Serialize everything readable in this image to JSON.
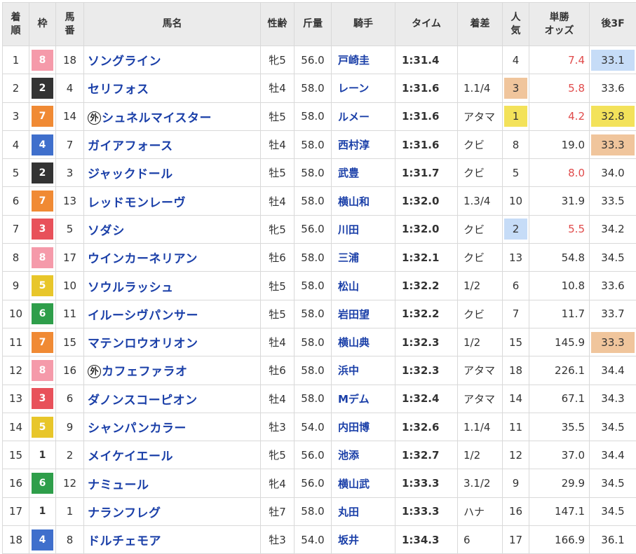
{
  "headers": {
    "rank": [
      "着",
      "順"
    ],
    "frame": "枠",
    "num": [
      "馬",
      "番"
    ],
    "name": "馬名",
    "sexage": "性齢",
    "weight": "斤量",
    "jockey": "騎手",
    "time": "タイム",
    "margin": "着差",
    "pop": [
      "人",
      "気"
    ],
    "odds": [
      "単勝",
      "オッズ"
    ],
    "last3f": "後3F"
  },
  "colors": {
    "frame_1": "#ffffff",
    "frame_2": "#333333",
    "frame_3": "#e8515a",
    "frame_4": "#3f6fcc",
    "frame_5": "#e8c62a",
    "frame_6": "#2e9e4a",
    "frame_7": "#f08a34",
    "frame_8": "#f59aaa",
    "pop_1": "#f3e25a",
    "pop_2": "#c6dcf7",
    "pop_3": "#f0c59c",
    "last3f_1": "#f3e25a",
    "last3f_2": "#c6dcf7",
    "last3f_3": "#f0c59c",
    "odds_highlight": "#e04a4a"
  },
  "rows": [
    {
      "rank": "1",
      "frame": "8",
      "num": "18",
      "gai": "",
      "name": "ソングライン",
      "sexage": "牝5",
      "weight": "56.0",
      "jockey": "戸崎圭",
      "time": "1:31.4",
      "margin": "",
      "pop": "4",
      "odds": "7.4",
      "last3f": "33.1",
      "pop_hl": "",
      "last_hl": "2",
      "odds_red": true
    },
    {
      "rank": "2",
      "frame": "2",
      "num": "4",
      "gai": "",
      "name": "セリフォス",
      "sexage": "牡4",
      "weight": "58.0",
      "jockey": "レーン",
      "time": "1:31.6",
      "margin": "1.1/4",
      "pop": "3",
      "odds": "5.8",
      "last3f": "33.6",
      "pop_hl": "3",
      "last_hl": "",
      "odds_red": true
    },
    {
      "rank": "3",
      "frame": "7",
      "num": "14",
      "gai": "外",
      "name": "シュネルマイスター",
      "sexage": "牡5",
      "weight": "58.0",
      "jockey": "ルメー",
      "time": "1:31.6",
      "margin": "アタマ",
      "pop": "1",
      "odds": "4.2",
      "last3f": "32.8",
      "pop_hl": "1",
      "last_hl": "1",
      "odds_red": true
    },
    {
      "rank": "4",
      "frame": "4",
      "num": "7",
      "gai": "",
      "name": "ガイアフォース",
      "sexage": "牡4",
      "weight": "58.0",
      "jockey": "西村淳",
      "time": "1:31.6",
      "margin": "クビ",
      "pop": "8",
      "odds": "19.0",
      "last3f": "33.3",
      "pop_hl": "",
      "last_hl": "3",
      "odds_red": false
    },
    {
      "rank": "5",
      "frame": "2",
      "num": "3",
      "gai": "",
      "name": "ジャックドール",
      "sexage": "牡5",
      "weight": "58.0",
      "jockey": "武豊",
      "time": "1:31.7",
      "margin": "クビ",
      "pop": "5",
      "odds": "8.0",
      "last3f": "34.0",
      "pop_hl": "",
      "last_hl": "",
      "odds_red": true
    },
    {
      "rank": "6",
      "frame": "7",
      "num": "13",
      "gai": "",
      "name": "レッドモンレーヴ",
      "sexage": "牡4",
      "weight": "58.0",
      "jockey": "横山和",
      "time": "1:32.0",
      "margin": "1.3/4",
      "pop": "10",
      "odds": "31.9",
      "last3f": "33.5",
      "pop_hl": "",
      "last_hl": "",
      "odds_red": false
    },
    {
      "rank": "7",
      "frame": "3",
      "num": "5",
      "gai": "",
      "name": "ソダシ",
      "sexage": "牝5",
      "weight": "56.0",
      "jockey": "川田",
      "time": "1:32.0",
      "margin": "クビ",
      "pop": "2",
      "odds": "5.5",
      "last3f": "34.2",
      "pop_hl": "2",
      "last_hl": "",
      "odds_red": true
    },
    {
      "rank": "8",
      "frame": "8",
      "num": "17",
      "gai": "",
      "name": "ウインカーネリアン",
      "sexage": "牡6",
      "weight": "58.0",
      "jockey": "三浦",
      "time": "1:32.1",
      "margin": "クビ",
      "pop": "13",
      "odds": "54.8",
      "last3f": "34.5",
      "pop_hl": "",
      "last_hl": "",
      "odds_red": false
    },
    {
      "rank": "9",
      "frame": "5",
      "num": "10",
      "gai": "",
      "name": "ソウルラッシュ",
      "sexage": "牡5",
      "weight": "58.0",
      "jockey": "松山",
      "time": "1:32.2",
      "margin": "1/2",
      "pop": "6",
      "odds": "10.8",
      "last3f": "33.6",
      "pop_hl": "",
      "last_hl": "",
      "odds_red": false
    },
    {
      "rank": "10",
      "frame": "6",
      "num": "11",
      "gai": "",
      "name": "イルーシヴパンサー",
      "sexage": "牡5",
      "weight": "58.0",
      "jockey": "岩田望",
      "time": "1:32.2",
      "margin": "クビ",
      "pop": "7",
      "odds": "11.7",
      "last3f": "33.7",
      "pop_hl": "",
      "last_hl": "",
      "odds_red": false
    },
    {
      "rank": "11",
      "frame": "7",
      "num": "15",
      "gai": "",
      "name": "マテンロウオリオン",
      "sexage": "牡4",
      "weight": "58.0",
      "jockey": "横山典",
      "time": "1:32.3",
      "margin": "1/2",
      "pop": "15",
      "odds": "145.9",
      "last3f": "33.3",
      "pop_hl": "",
      "last_hl": "3",
      "odds_red": false
    },
    {
      "rank": "12",
      "frame": "8",
      "num": "16",
      "gai": "外",
      "name": "カフェファラオ",
      "sexage": "牡6",
      "weight": "58.0",
      "jockey": "浜中",
      "time": "1:32.3",
      "margin": "アタマ",
      "pop": "18",
      "odds": "226.1",
      "last3f": "34.4",
      "pop_hl": "",
      "last_hl": "",
      "odds_red": false
    },
    {
      "rank": "13",
      "frame": "3",
      "num": "6",
      "gai": "",
      "name": "ダノンスコーピオン",
      "sexage": "牡4",
      "weight": "58.0",
      "jockey": "Mデム",
      "time": "1:32.4",
      "margin": "アタマ",
      "pop": "14",
      "odds": "67.1",
      "last3f": "34.3",
      "pop_hl": "",
      "last_hl": "",
      "odds_red": false
    },
    {
      "rank": "14",
      "frame": "5",
      "num": "9",
      "gai": "",
      "name": "シャンパンカラー",
      "sexage": "牡3",
      "weight": "54.0",
      "jockey": "内田博",
      "time": "1:32.6",
      "margin": "1.1/4",
      "pop": "11",
      "odds": "35.5",
      "last3f": "34.5",
      "pop_hl": "",
      "last_hl": "",
      "odds_red": false
    },
    {
      "rank": "15",
      "frame": "1",
      "num": "2",
      "gai": "",
      "name": "メイケイエール",
      "sexage": "牝5",
      "weight": "56.0",
      "jockey": "池添",
      "time": "1:32.7",
      "margin": "1/2",
      "pop": "12",
      "odds": "37.0",
      "last3f": "34.4",
      "pop_hl": "",
      "last_hl": "",
      "odds_red": false
    },
    {
      "rank": "16",
      "frame": "6",
      "num": "12",
      "gai": "",
      "name": "ナミュール",
      "sexage": "牝4",
      "weight": "56.0",
      "jockey": "横山武",
      "time": "1:33.3",
      "margin": "3.1/2",
      "pop": "9",
      "odds": "29.9",
      "last3f": "34.5",
      "pop_hl": "",
      "last_hl": "",
      "odds_red": false
    },
    {
      "rank": "17",
      "frame": "1",
      "num": "1",
      "gai": "",
      "name": "ナランフレグ",
      "sexage": "牡7",
      "weight": "58.0",
      "jockey": "丸田",
      "time": "1:33.3",
      "margin": "ハナ",
      "pop": "16",
      "odds": "147.1",
      "last3f": "34.5",
      "pop_hl": "",
      "last_hl": "",
      "odds_red": false
    },
    {
      "rank": "18",
      "frame": "4",
      "num": "8",
      "gai": "",
      "name": "ドルチェモア",
      "sexage": "牡3",
      "weight": "54.0",
      "jockey": "坂井",
      "time": "1:34.3",
      "margin": "6",
      "pop": "17",
      "odds": "166.9",
      "last3f": "36.1",
      "pop_hl": "",
      "last_hl": "",
      "odds_red": false
    }
  ]
}
